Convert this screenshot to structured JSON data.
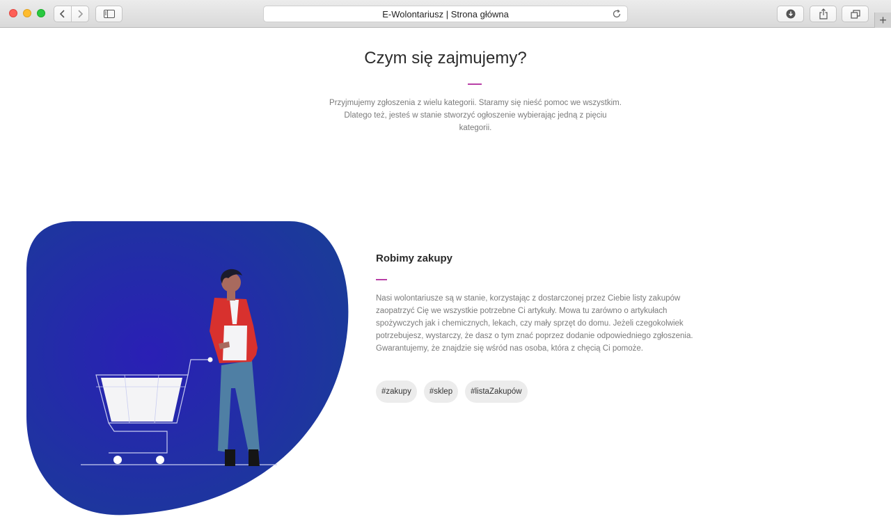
{
  "browser": {
    "window_title": "E-Wolontariusz | Strona główna",
    "icons": {
      "back": "chevron-left-icon",
      "forward": "chevron-right-icon",
      "sidebar": "sidebar-icon",
      "reload": "reload-icon",
      "download": "download-icon",
      "share": "share-icon",
      "tabs": "tabs-icon",
      "new_tab": "plus-icon"
    },
    "new_tab_label": "+"
  },
  "section": {
    "title": "Czym się zajmujemy?",
    "intro": "Przyjmujemy zgłoszenia z wielu kategorii. Staramy się nieść pomoc we wszystkim. Dlatego też, jesteś w stanie stworzyć ogłoszenie wybierając jedną z pięciu kategorii.",
    "accent_color": "#b83fa6"
  },
  "category": {
    "title": "Robimy zakupy",
    "description": "Nasi wolontariusze są w stanie, korzystając z dostarczonej przez Ciebie listy zakupów zaopatrzyć Cię we wszystkie potrzebne Ci artykuły. Mowa tu zarówno o artykułach spożywczych jak i chemicznych, lekach, czy mały sprzęt do domu. Jeżeli czegokolwiek potrzebujesz, wystarczy, że dasz o tym znać poprzez dodanie odpowiedniego zgłoszenia. Gwarantujemy, że znajdzie się wśród nas osoba, która z chęcią Ci pomoże.",
    "tags": [
      "#zakupy",
      "#sklep",
      "#listaZakupów"
    ],
    "illustration": "shopping-cart-person-illustration",
    "blob_colors": [
      "#2a1fb5",
      "#1a3c98"
    ]
  }
}
